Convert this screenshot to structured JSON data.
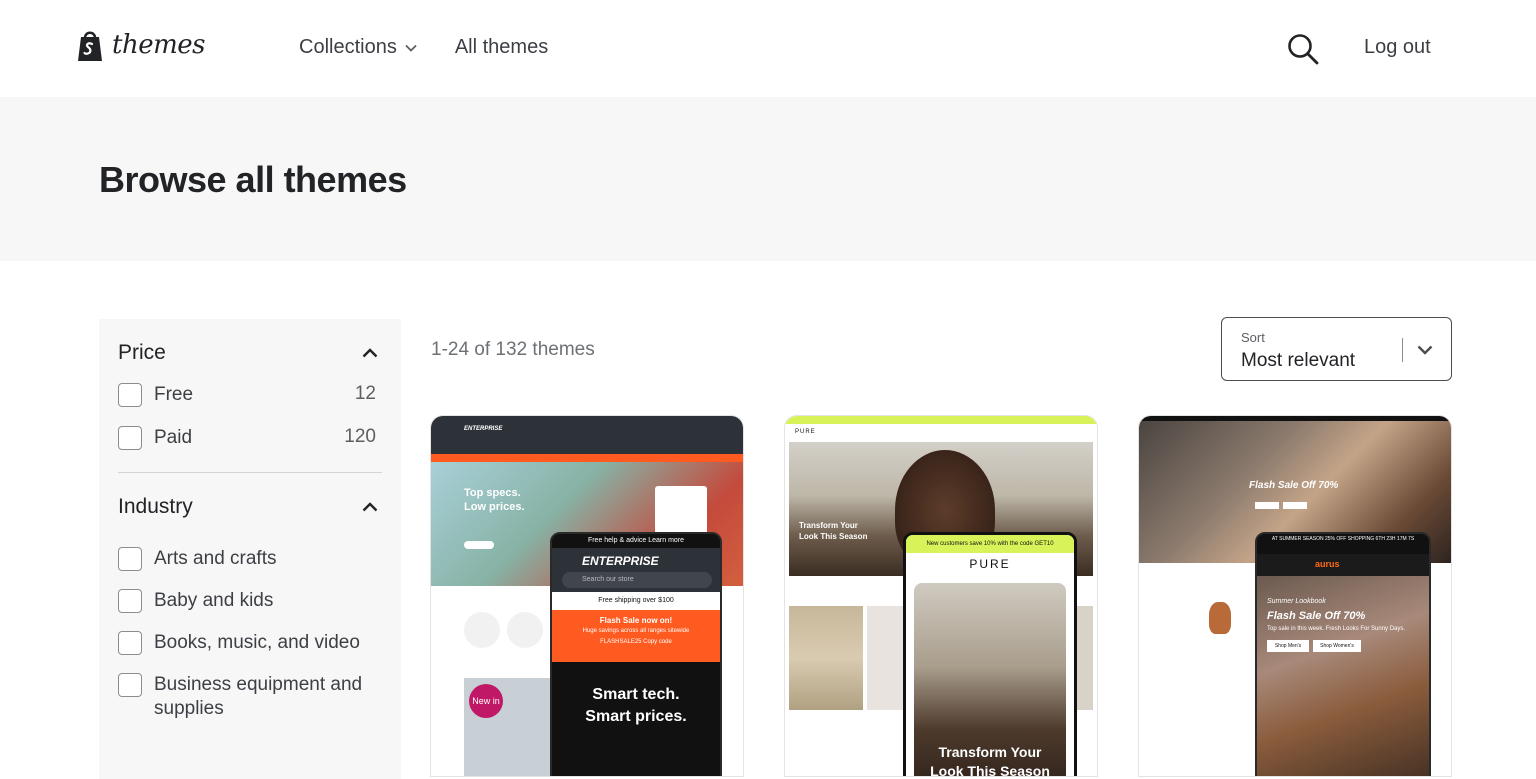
{
  "header": {
    "logo_text": "themes",
    "nav": [
      {
        "label": "Collections"
      },
      {
        "label": "All themes"
      }
    ],
    "logout_label": "Log out"
  },
  "hero": {
    "title": "Browse all themes"
  },
  "filters": {
    "price": {
      "title": "Price",
      "options": [
        {
          "label": "Free",
          "count": "12"
        },
        {
          "label": "Paid",
          "count": "120"
        }
      ]
    },
    "industry": {
      "title": "Industry",
      "options": [
        {
          "label": "Arts and crafts"
        },
        {
          "label": "Baby and kids"
        },
        {
          "label": "Books, music, and video"
        },
        {
          "label": "Business equipment and supplies"
        }
      ]
    }
  },
  "results": {
    "count_text": "1-24 of 132 themes",
    "sort_label": "Sort",
    "sort_value": "Most relevant"
  },
  "cards": [
    {
      "brand": "ENTERPRISE",
      "hero_line1": "Top specs.",
      "hero_line2": "Low prices.",
      "badge": "New in",
      "phone_top": "Free help & advice Learn more",
      "phone_brand": "ENTERPRISE",
      "phone_search": "Search our store",
      "phone_ship": "Free shipping over $100",
      "phone_flash": "Flash Sale now on!",
      "phone_flash_sub": "Huge savings across all ranges sitewide",
      "phone_code": "FLASHSALE25   Copy code",
      "phone_line1": "Smart tech.",
      "phone_line2": "Smart prices."
    },
    {
      "brand": "PURE",
      "hero_line1": "Transform Your",
      "hero_line2": "Look This Season",
      "phone_top": "New customers save 10% with the code GET10",
      "phone_brand": "PURE",
      "phone_line1": "Transform Your",
      "phone_line2": "Look This Season"
    },
    {
      "hero_text": "Flash Sale Off 70%",
      "phone_top": "AT SUMMER SEASON 25% OFF SHOPPING 6TH 23H 17M 7S",
      "phone_brand": "aurus",
      "phone_sub": "Summer Lookbook",
      "phone_flash": "Flash Sale Off 70%",
      "phone_desc": "Top sale in this week. Fresh Looks For Sunny Days.",
      "phone_btn1": "Shop Men's",
      "phone_btn2": "Shop Women's"
    }
  ]
}
